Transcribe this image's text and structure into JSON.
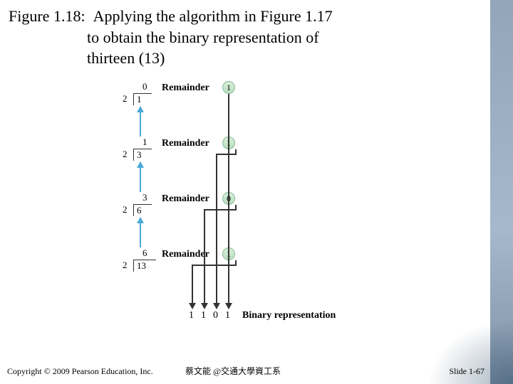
{
  "title": {
    "figure_label": "Figure 1.18:",
    "text_line1": "Applying the algorithm in Figure 1.17",
    "text_line2": "to obtain the binary representation of",
    "text_line3": "thirteen (13)"
  },
  "steps": [
    {
      "divisor": "2",
      "dividend": "1",
      "quotient": "0",
      "rem_label": "Remainder",
      "remainder": "1"
    },
    {
      "divisor": "2",
      "dividend": "3",
      "quotient": "1",
      "rem_label": "Remainder",
      "remainder": "1"
    },
    {
      "divisor": "2",
      "dividend": "6",
      "quotient": "3",
      "rem_label": "Remainder",
      "remainder": "0"
    },
    {
      "divisor": "2",
      "dividend": "13",
      "quotient": "6",
      "rem_label": "Remainder",
      "remainder": "1"
    }
  ],
  "binary": {
    "bits": [
      "1",
      "1",
      "0",
      "1"
    ],
    "label": "Binary representation"
  },
  "footer": {
    "copyright": "Copyright © 2009 Pearson Education, Inc.",
    "center": "蔡文能 @交通大學資工系",
    "slide": "Slide 1-67"
  }
}
